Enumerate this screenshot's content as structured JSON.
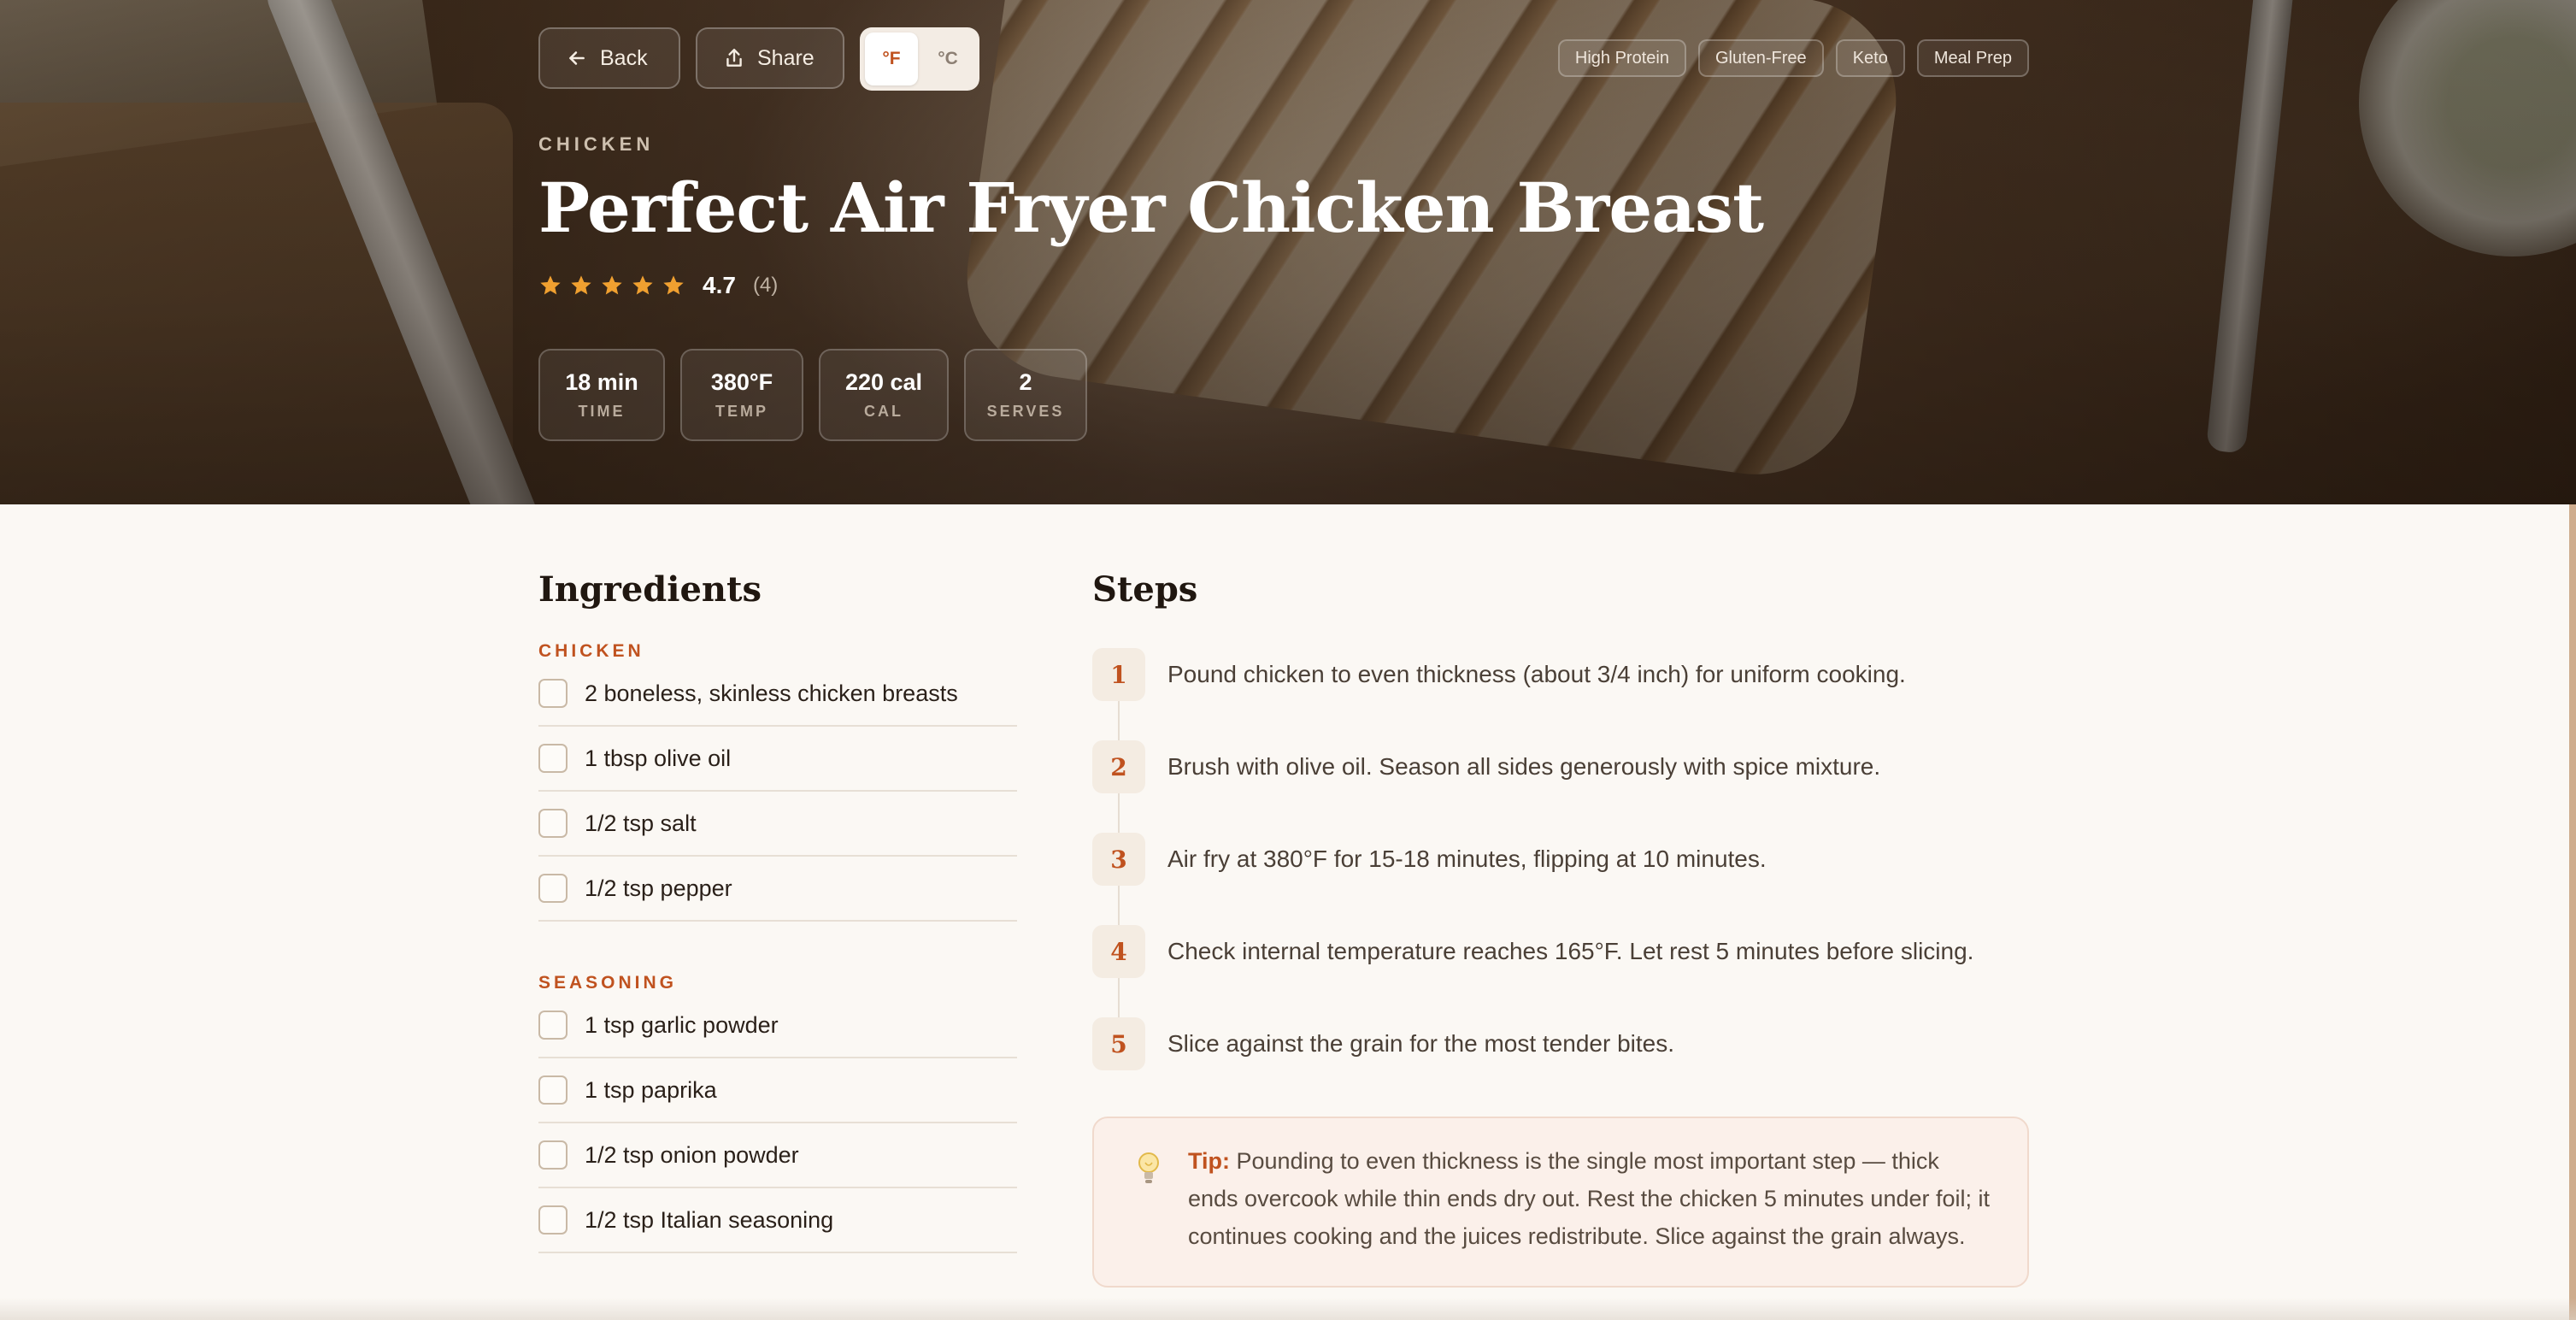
{
  "header": {
    "back_label": "Back",
    "share_label": "Share",
    "unit_f": "°F",
    "unit_c": "°C",
    "tags": [
      "High Protein",
      "Gluten-Free",
      "Keto",
      "Meal Prep"
    ]
  },
  "recipe": {
    "category": "CHICKEN",
    "title": "Perfect Air Fryer Chicken Breast",
    "rating": "4.7",
    "rating_stars": 5,
    "rating_count": "(4)",
    "stats": [
      {
        "value": "18 min",
        "label": "TIME"
      },
      {
        "value": "380°F",
        "label": "TEMP"
      },
      {
        "value": "220 cal",
        "label": "CAL"
      },
      {
        "value": "2",
        "label": "SERVES"
      }
    ]
  },
  "ingredients": {
    "heading": "Ingredients",
    "groups": [
      {
        "name": "CHICKEN",
        "items": [
          "2 boneless, skinless chicken breasts",
          "1 tbsp olive oil",
          "1/2 tsp salt",
          "1/2 tsp pepper"
        ]
      },
      {
        "name": "SEASONING",
        "items": [
          "1 tsp garlic powder",
          "1 tsp paprika",
          "1/2 tsp onion powder",
          "1/2 tsp Italian seasoning"
        ]
      }
    ]
  },
  "steps": {
    "heading": "Steps",
    "items": [
      {
        "num": "1",
        "text": "Pound chicken to even thickness (about 3/4 inch) for uniform cooking."
      },
      {
        "num": "2",
        "text": "Brush with olive oil. Season all sides generously with spice mixture."
      },
      {
        "num": "3",
        "text": "Air fry at 380°F for 15-18 minutes, flipping at 10 minutes."
      },
      {
        "num": "4",
        "text": "Check internal temperature reaches 165°F. Let rest 5 minutes before slicing."
      },
      {
        "num": "5",
        "text": "Slice against the grain for the most tender bites."
      }
    ]
  },
  "tip": {
    "label": "Tip:",
    "text": "Pounding to even thickness is the single most important step — thick ends overcook while thin ends dry out. Rest the chicken 5 minutes under foil; it continues cooking and the juices redistribute. Slice against the grain always."
  },
  "colors": {
    "accent": "#c0521f",
    "star": "#f0a030",
    "page_bg": "#fbf8f4"
  },
  "icons": {
    "back": "arrow-left-icon",
    "share": "share-icon",
    "star": "star-icon",
    "tip": "lightbulb-icon"
  }
}
